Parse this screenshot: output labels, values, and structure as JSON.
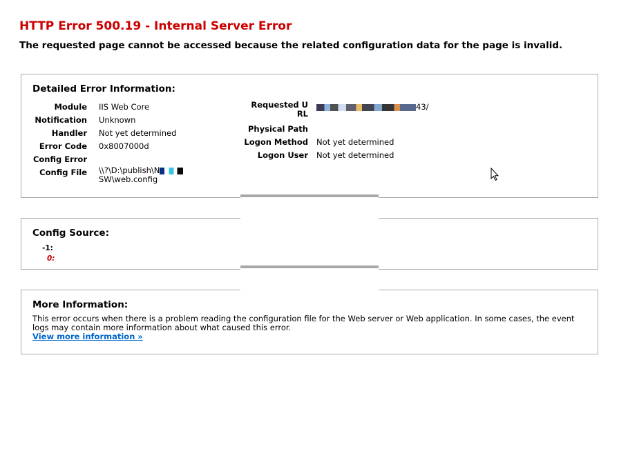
{
  "header": {
    "title": "HTTP Error 500.19 - Internal Server Error",
    "subtitle": "The requested page cannot be accessed because the related configuration data for the page is invalid."
  },
  "detailed": {
    "heading": "Detailed Error Information:",
    "left": [
      {
        "key": "Module",
        "value": "IIS Web Core"
      },
      {
        "key": "Notification",
        "value": "Unknown"
      },
      {
        "key": "Handler",
        "value": "Not yet determined"
      },
      {
        "key": "Error Code",
        "value": "0x8007000d"
      },
      {
        "key": "Config Error",
        "value": ""
      },
      {
        "key": "Config File",
        "value_prefix": "\\\\?\\D:\\publish\\N",
        "value_suffix": "SW\\web.config"
      }
    ],
    "right": [
      {
        "key": "Requested URL",
        "value_suffix": "43/"
      },
      {
        "key": "Physical Path",
        "value": ""
      },
      {
        "key": "Logon Method",
        "value": "Not yet determined"
      },
      {
        "key": "Logon User",
        "value": "Not yet determined"
      }
    ]
  },
  "config_source": {
    "heading": "Config Source:",
    "lines": [
      "-1:",
      "0:"
    ]
  },
  "more_info": {
    "heading": "More Information:",
    "text": "This error occurs when there is a problem reading the configuration file for the Web server or Web application. In some cases, the event logs may contain more information about what caused this error.",
    "link_label": "View more information »"
  },
  "colors": {
    "title_red": "#cc0000",
    "link_blue": "#0066cc",
    "border_gray": "#a8a8a8"
  }
}
